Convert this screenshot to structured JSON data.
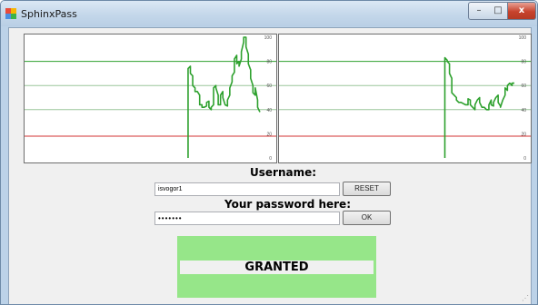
{
  "window": {
    "title": "SphinxPass",
    "controls": {
      "minimize": "–",
      "maximize": "□",
      "close": "x"
    }
  },
  "form": {
    "username_label": "Username:",
    "username_value": "isvogor1",
    "reset_label": "RESET",
    "password_label": "Your password here:",
    "password_value": "•••••••",
    "ok_label": "OK",
    "result_text": "GRANTED",
    "result_color": "#96e689"
  },
  "chart_data": [
    {
      "type": "line",
      "y_ticks": [
        100,
        80,
        60,
        40,
        20,
        0
      ],
      "ylim": [
        0,
        100
      ],
      "xlim": [
        0,
        100
      ],
      "series": [
        {
          "color": "#2ea12e",
          "points": [
            [
              69,
              0
            ],
            [
              69,
              74
            ],
            [
              70,
              76
            ],
            [
              70,
              70
            ],
            [
              71,
              68
            ],
            [
              71,
              60
            ],
            [
              72,
              58
            ],
            [
              72,
              55
            ],
            [
              73,
              55
            ],
            [
              74,
              52
            ],
            [
              74,
              44
            ],
            [
              75,
              44
            ],
            [
              75,
              42
            ],
            [
              76,
              42
            ],
            [
              77,
              43
            ],
            [
              77,
              46
            ],
            [
              78,
              47
            ],
            [
              78,
              42
            ],
            [
              79,
              40
            ],
            [
              79,
              42
            ],
            [
              80,
              44
            ],
            [
              80,
              58
            ],
            [
              81,
              60
            ],
            [
              81,
              58
            ],
            [
              82,
              52
            ],
            [
              82,
              44
            ],
            [
              83,
              44
            ],
            [
              83,
              52
            ],
            [
              84,
              55
            ],
            [
              84,
              50
            ],
            [
              85,
              44
            ],
            [
              86,
              43
            ],
            [
              86,
              48
            ],
            [
              87,
              52
            ],
            [
              87,
              58
            ],
            [
              88,
              63
            ],
            [
              88,
              68
            ],
            [
              89,
              71
            ],
            [
              89,
              82
            ],
            [
              90,
              85
            ],
            [
              90,
              78
            ],
            [
              91,
              80
            ],
            [
              91,
              76
            ],
            [
              92,
              82
            ],
            [
              92,
              88
            ],
            [
              93,
              96
            ],
            [
              93,
              100
            ],
            [
              94,
              100
            ],
            [
              94,
              92
            ],
            [
              95,
              86
            ],
            [
              95,
              78
            ],
            [
              96,
              73
            ],
            [
              96,
              66
            ],
            [
              97,
              60
            ],
            [
              97,
              54
            ],
            [
              98,
              52
            ],
            [
              98,
              58
            ],
            [
              99,
              48
            ],
            [
              99,
              42
            ],
            [
              100,
              38
            ]
          ]
        }
      ],
      "reference_lines": [
        {
          "y": 80,
          "color": "#2ea12e"
        },
        {
          "y": 60,
          "color": "#9ac59a"
        },
        {
          "y": 40,
          "color": "#9ac59a"
        },
        {
          "y": 18,
          "color": "#d33333"
        }
      ]
    },
    {
      "type": "line",
      "y_ticks": [
        100,
        80,
        60,
        40,
        20,
        0
      ],
      "ylim": [
        0,
        100
      ],
      "xlim": [
        0,
        100
      ],
      "series": [
        {
          "color": "#2ea12e",
          "points": [
            [
              70,
              0
            ],
            [
              70,
              83
            ],
            [
              71,
              81
            ],
            [
              71,
              80
            ],
            [
              72,
              78
            ],
            [
              72,
              70
            ],
            [
              73,
              66
            ],
            [
              73,
              54
            ],
            [
              74,
              52
            ],
            [
              75,
              50
            ],
            [
              75,
              48
            ],
            [
              76,
              46
            ],
            [
              77,
              46
            ],
            [
              78,
              45
            ],
            [
              79,
              44
            ],
            [
              80,
              44
            ],
            [
              80,
              49
            ],
            [
              81,
              48
            ],
            [
              81,
              44
            ],
            [
              82,
              42
            ],
            [
              83,
              40
            ],
            [
              83,
              44
            ],
            [
              84,
              48
            ],
            [
              85,
              50
            ],
            [
              85,
              46
            ],
            [
              86,
              42
            ],
            [
              87,
              42
            ],
            [
              88,
              40
            ],
            [
              89,
              40
            ],
            [
              89,
              44
            ],
            [
              90,
              48
            ],
            [
              90,
              44
            ],
            [
              91,
              43
            ],
            [
              91,
              46
            ],
            [
              92,
              50
            ],
            [
              93,
              52
            ],
            [
              93,
              46
            ],
            [
              94,
              43
            ],
            [
              94,
              42
            ],
            [
              95,
              48
            ],
            [
              96,
              52
            ],
            [
              96,
              58
            ],
            [
              97,
              56
            ],
            [
              97,
              60
            ],
            [
              98,
              62
            ],
            [
              99,
              60
            ],
            [
              99,
              62
            ],
            [
              100,
              62
            ]
          ]
        }
      ],
      "reference_lines": [
        {
          "y": 80,
          "color": "#2ea12e"
        },
        {
          "y": 60,
          "color": "#9ac59a"
        },
        {
          "y": 40,
          "color": "#9ac59a"
        },
        {
          "y": 18,
          "color": "#d33333"
        }
      ]
    }
  ]
}
